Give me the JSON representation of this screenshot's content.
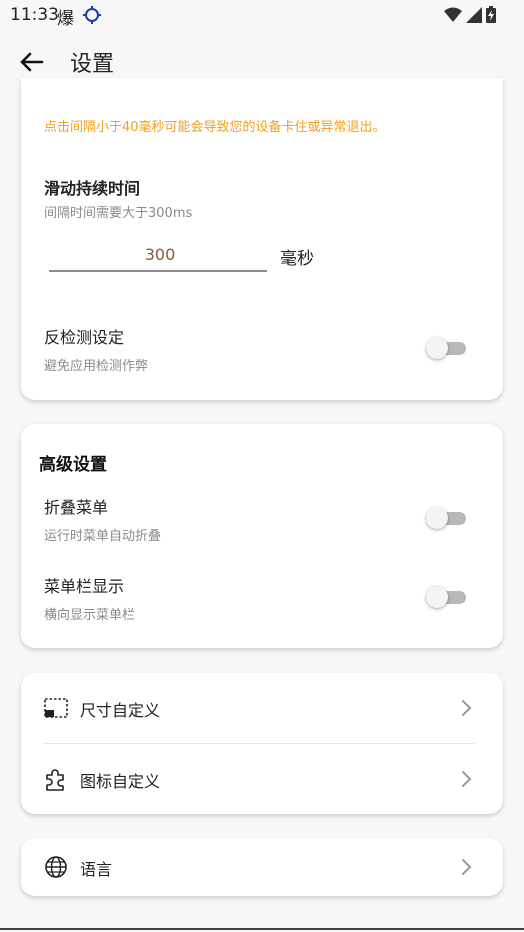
{
  "status": {
    "time": "11:33",
    "notify_glyph": "爆",
    "icons": [
      "crosshair-icon",
      "wifi-icon",
      "signal-icon",
      "battery-icon"
    ]
  },
  "header": {
    "title": "设置"
  },
  "click_card": {
    "warning": "点击间隔小于40毫秒可能会导致您的设备卡住或异常退出。",
    "swipe_duration_label": "滑动持续时间",
    "swipe_duration_sub": "间隔时间需要大于300ms",
    "swipe_duration_value": "300",
    "swipe_duration_unit": "毫秒",
    "anti_detect_label": "反检测设定",
    "anti_detect_sub": "避免应用检测作弊",
    "anti_detect_on": false
  },
  "advanced": {
    "title": "高级设置",
    "fold_menu_label": "折叠菜单",
    "fold_menu_sub": "运行时菜单自动折叠",
    "fold_menu_on": false,
    "menubar_label": "菜单栏显示",
    "menubar_sub": "横向显示菜单栏",
    "menubar_on": false
  },
  "custom": {
    "size_label": "尺寸自定义",
    "icon_label": "图标自定义"
  },
  "language": {
    "label": "语言"
  },
  "colors": {
    "warning": "#f0a020",
    "input_text": "#8a5a3a",
    "toggle_track": "#b8b8b8",
    "background": "#f7f7f7"
  }
}
